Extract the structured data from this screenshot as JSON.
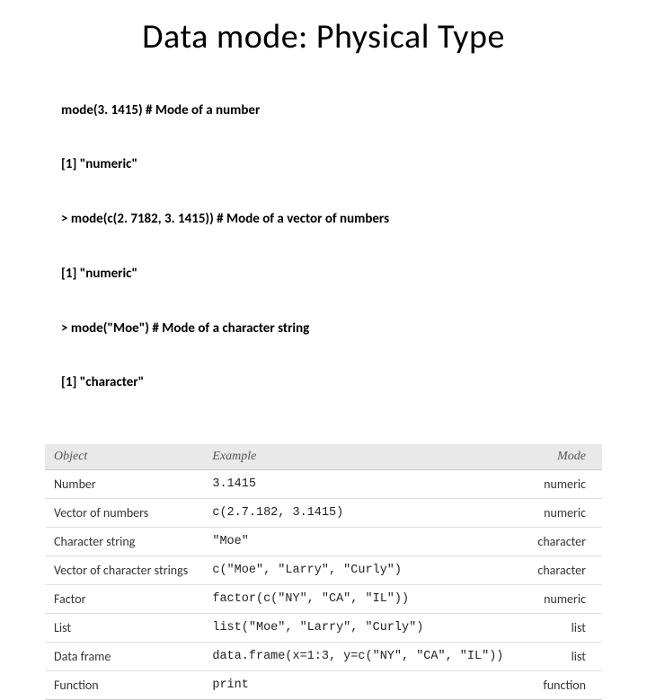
{
  "title": "Data mode: Physical Type",
  "code_lines": [
    "mode(3. 1415) # Mode of a number",
    "[1] \"numeric\"",
    "> mode(c(2. 7182, 3. 1415)) # Mode of a vector of numbers",
    "[1] \"numeric\"",
    "> mode(\"Moe\") # Mode of a character string",
    "[1] \"character\""
  ],
  "table": {
    "headers": [
      "Object",
      "Example",
      "Mode"
    ],
    "rows": [
      {
        "object": "Number",
        "example": "3.1415",
        "mode": "numeric"
      },
      {
        "object": "Vector of numbers",
        "example": "c(2.7.182, 3.1415)",
        "mode": "numeric"
      },
      {
        "object": "Character string",
        "example": "\"Moe\"",
        "mode": "character"
      },
      {
        "object": "Vector of character strings",
        "example": "c(\"Moe\", \"Larry\", \"Curly\")",
        "mode": "character"
      },
      {
        "object": "Factor",
        "example": "factor(c(\"NY\", \"CA\", \"IL\"))",
        "mode": "numeric"
      },
      {
        "object": "List",
        "example": "list(\"Moe\", \"Larry\", \"Curly\")",
        "mode": "list"
      },
      {
        "object": "Data frame",
        "example": "data.frame(x=1:3, y=c(\"NY\", \"CA\", \"IL\"))",
        "mode": "list"
      },
      {
        "object": "Function",
        "example": "print",
        "mode": "function"
      }
    ]
  }
}
